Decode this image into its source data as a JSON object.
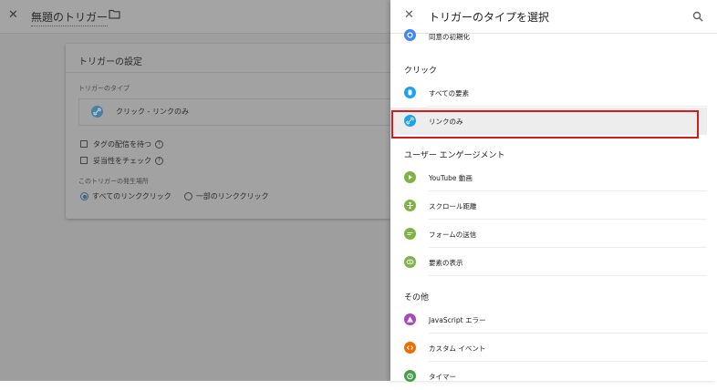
{
  "background": {
    "title": "無題のトリガー",
    "card": {
      "title": "トリガーの設定",
      "type_label": "トリガーのタイプ",
      "type_value": "クリック - リンクのみ",
      "checkboxes": [
        {
          "label": "タグの配信を待つ"
        },
        {
          "label": "妥当性をチェック"
        }
      ],
      "fire_label": "このトリガーの発生場所",
      "radios": [
        {
          "label": "すべてのリンククリック",
          "selected": true
        },
        {
          "label": "一部のリンククリック",
          "selected": false
        }
      ]
    }
  },
  "drawer": {
    "title": "トリガーのタイプを選択",
    "partial_item": {
      "label": "同意の初期化",
      "icon": "consent-icon",
      "color": "#4285f4"
    },
    "sections": [
      {
        "name": "クリック",
        "items": [
          {
            "label": "すべての要素",
            "icon": "pointer-icon",
            "color": "#1da1f2"
          },
          {
            "label": "リンクのみ",
            "icon": "link-icon",
            "color": "#1da1f2",
            "selected": true
          }
        ]
      },
      {
        "name": "ユーザー エンゲージメント",
        "items": [
          {
            "label": "YouTube 動画",
            "icon": "play-icon",
            "color": "#7cb342"
          },
          {
            "label": "スクロール距離",
            "icon": "scroll-icon",
            "color": "#7cb342"
          },
          {
            "label": "フォームの送信",
            "icon": "form-icon",
            "color": "#7cb342"
          },
          {
            "label": "要素の表示",
            "icon": "eye-icon",
            "color": "#7cb342"
          }
        ]
      },
      {
        "name": "その他",
        "items": [
          {
            "label": "JavaScript エラー",
            "icon": "warning-icon",
            "color": "#ab47bc"
          },
          {
            "label": "カスタム イベント",
            "icon": "code-icon",
            "color": "#ef6c00"
          },
          {
            "label": "タイマー",
            "icon": "timer-icon",
            "color": "#43a047"
          }
        ]
      }
    ]
  }
}
